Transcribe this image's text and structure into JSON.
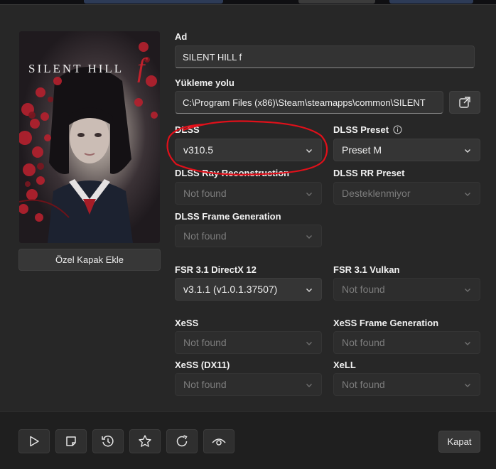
{
  "background_tabs": [
    {
      "color": "#2d3b57"
    },
    {
      "color": "#3b3b3b"
    },
    {
      "color": "#2d3b57"
    }
  ],
  "cover": {
    "title": "SILENT HILL",
    "title_suffix": "f",
    "add_cover_label": "Özel Kapak Ekle"
  },
  "fields": {
    "name": {
      "label": "Ad",
      "value": "SILENT HILL f"
    },
    "install_path": {
      "label": "Yükleme yolu",
      "value": "C:\\Program Files (x86)\\Steam\\steamapps\\common\\SILENT"
    }
  },
  "options": {
    "dlss": {
      "label": "DLSS",
      "value": "v310.5",
      "enabled": true
    },
    "dlss_preset": {
      "label": "DLSS Preset",
      "value": "Preset M",
      "enabled": true
    },
    "dlss_rr": {
      "label": "DLSS Ray Reconstruction",
      "value": "Not found",
      "enabled": false
    },
    "dlss_rr_preset": {
      "label": "DLSS RR Preset",
      "value": "Desteklenmiyor",
      "enabled": false
    },
    "dlss_fg": {
      "label": "DLSS Frame Generation",
      "value": "Not found",
      "enabled": false
    },
    "fsr_dx12": {
      "label": "FSR 3.1 DirectX 12",
      "value": "v3.1.1 (v1.0.1.37507)",
      "enabled": true
    },
    "fsr_vulkan": {
      "label": "FSR 3.1 Vulkan",
      "value": "Not found",
      "enabled": false
    },
    "xess": {
      "label": "XeSS",
      "value": "Not found",
      "enabled": false
    },
    "xess_fg": {
      "label": "XeSS Frame Generation",
      "value": "Not found",
      "enabled": false
    },
    "xess_dx11": {
      "label": "XeSS (DX11)",
      "value": "Not found",
      "enabled": false
    },
    "xell": {
      "label": "XeLL",
      "value": "Not found",
      "enabled": false
    }
  },
  "annotation": {
    "color": "#e0101a"
  },
  "footer": {
    "toolbar_icons": [
      "play-icon",
      "sticky-note-icon",
      "history-icon",
      "star-icon",
      "refresh-icon",
      "eye-icon"
    ],
    "close_label": "Kapat"
  }
}
